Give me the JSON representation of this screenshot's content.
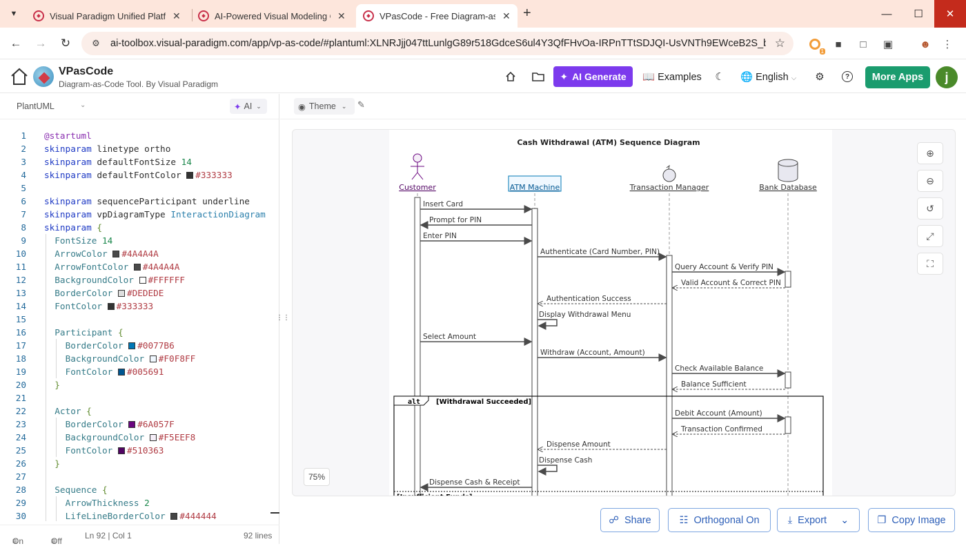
{
  "browser": {
    "tabs": [
      {
        "title": "Visual Paradigm Unified Platform"
      },
      {
        "title": "AI-Powered Visual Modeling Chatbot"
      },
      {
        "title": "VPasCode - Free Diagram-as-Code Tool"
      }
    ],
    "url": "ai-toolbox.visual-paradigm.com/app/vp-as-code/#plantuml:XLNRJjj047ttLunlgG89r518GdceS6ul4Y3QfFHvOa-IRPnTTtSDJQI-UsVNTh9EWceB2S_bd3ENt...",
    "ext_badge": "1"
  },
  "app": {
    "title": "VPasCode",
    "subtitle": "Diagram-as-Code Tool. By Visual Paradigm",
    "ai_generate": "AI Generate",
    "examples": "Examples",
    "language": "English",
    "more_apps": "More Apps",
    "avatar_initial": "j"
  },
  "editor": {
    "language": "PlantUML",
    "ai_label": "AI",
    "lines": [
      {
        "n": "1",
        "parts": [
          [
            "dir",
            "@startuml"
          ]
        ]
      },
      {
        "n": "2",
        "parts": [
          [
            "kw",
            "skinparam"
          ],
          [
            "pl",
            " linetype ortho"
          ]
        ]
      },
      {
        "n": "3",
        "parts": [
          [
            "kw",
            "skinparam"
          ],
          [
            "pl",
            " defaultFontSize "
          ],
          [
            "num",
            "14"
          ]
        ]
      },
      {
        "n": "4",
        "parts": [
          [
            "kw",
            "skinparam"
          ],
          [
            "pl",
            " defaultFontColor "
          ],
          [
            "sw",
            "#333333"
          ],
          [
            "hex",
            "#333333"
          ]
        ]
      },
      {
        "n": "5",
        "parts": []
      },
      {
        "n": "6",
        "parts": [
          [
            "kw",
            "skinparam"
          ],
          [
            "pl",
            " sequenceParticipant underline"
          ]
        ]
      },
      {
        "n": "7",
        "parts": [
          [
            "kw",
            "skinparam"
          ],
          [
            "pl",
            " vpDiagramType "
          ],
          [
            "val",
            "InteractionDiagram"
          ]
        ]
      },
      {
        "n": "8",
        "parts": [
          [
            "kw",
            "skinparam"
          ],
          [
            "pl",
            " "
          ],
          [
            "br",
            "{"
          ]
        ]
      },
      {
        "n": "9",
        "indent": 1,
        "parts": [
          [
            "prop",
            "FontSize "
          ],
          [
            "num",
            "14"
          ]
        ]
      },
      {
        "n": "10",
        "indent": 1,
        "parts": [
          [
            "prop",
            "ArrowColor "
          ],
          [
            "sw",
            "#4A4A4A"
          ],
          [
            "hex",
            "#4A4A4A"
          ]
        ]
      },
      {
        "n": "11",
        "indent": 1,
        "parts": [
          [
            "prop",
            "ArrowFontColor "
          ],
          [
            "sw",
            "#4A4A4A"
          ],
          [
            "hex",
            "#4A4A4A"
          ]
        ]
      },
      {
        "n": "12",
        "indent": 1,
        "parts": [
          [
            "prop",
            "BackgroundColor "
          ],
          [
            "sw",
            "#FFFFFF"
          ],
          [
            "hex",
            "#FFFFFF"
          ]
        ]
      },
      {
        "n": "13",
        "indent": 1,
        "parts": [
          [
            "prop",
            "BorderColor "
          ],
          [
            "sw",
            "#DEDEDE"
          ],
          [
            "hex",
            "#DEDEDE"
          ]
        ]
      },
      {
        "n": "14",
        "indent": 1,
        "parts": [
          [
            "prop",
            "FontColor "
          ],
          [
            "sw",
            "#333333"
          ],
          [
            "hex",
            "#333333"
          ]
        ]
      },
      {
        "n": "15",
        "indent": 1,
        "parts": []
      },
      {
        "n": "16",
        "indent": 1,
        "parts": [
          [
            "prop",
            "Participant "
          ],
          [
            "br",
            "{"
          ]
        ]
      },
      {
        "n": "17",
        "indent": 2,
        "parts": [
          [
            "prop",
            "BorderColor "
          ],
          [
            "sw",
            "#0077B6"
          ],
          [
            "hex",
            "#0077B6"
          ]
        ]
      },
      {
        "n": "18",
        "indent": 2,
        "parts": [
          [
            "prop",
            "BackgroundColor "
          ],
          [
            "sw",
            "#F0F8FF"
          ],
          [
            "hex",
            "#F0F8FF"
          ]
        ]
      },
      {
        "n": "19",
        "indent": 2,
        "parts": [
          [
            "prop",
            "FontColor "
          ],
          [
            "sw",
            "#005691"
          ],
          [
            "hex",
            "#005691"
          ]
        ]
      },
      {
        "n": "20",
        "indent": 1,
        "parts": [
          [
            "br",
            "}"
          ]
        ]
      },
      {
        "n": "21",
        "indent": 1,
        "parts": []
      },
      {
        "n": "22",
        "indent": 1,
        "parts": [
          [
            "prop",
            "Actor "
          ],
          [
            "br",
            "{"
          ]
        ]
      },
      {
        "n": "23",
        "indent": 2,
        "parts": [
          [
            "prop",
            "BorderColor "
          ],
          [
            "sw",
            "#6A057F"
          ],
          [
            "hex",
            "#6A057F"
          ]
        ]
      },
      {
        "n": "24",
        "indent": 2,
        "parts": [
          [
            "prop",
            "BackgroundColor "
          ],
          [
            "sw",
            "#F5EEF8"
          ],
          [
            "hex",
            "#F5EEF8"
          ]
        ]
      },
      {
        "n": "25",
        "indent": 2,
        "parts": [
          [
            "prop",
            "FontColor "
          ],
          [
            "sw",
            "#510363"
          ],
          [
            "hex",
            "#510363"
          ]
        ]
      },
      {
        "n": "26",
        "indent": 1,
        "parts": [
          [
            "br",
            "}"
          ]
        ]
      },
      {
        "n": "27",
        "indent": 1,
        "parts": []
      },
      {
        "n": "28",
        "indent": 1,
        "parts": [
          [
            "prop",
            "Sequence "
          ],
          [
            "br",
            "{"
          ]
        ]
      },
      {
        "n": "29",
        "indent": 2,
        "parts": [
          [
            "prop",
            "ArrowThickness "
          ],
          [
            "num",
            "2"
          ]
        ]
      },
      {
        "n": "30",
        "indent": 2,
        "parts": [
          [
            "prop",
            "LifeLineBorderColor "
          ],
          [
            "sw",
            "#444444"
          ],
          [
            "hex",
            "#444444"
          ]
        ]
      }
    ],
    "footer": {
      "wrap": "On",
      "format": "Off",
      "position": "Ln 92 | Col 1",
      "count": "92 lines"
    }
  },
  "preview": {
    "theme_label": "Theme",
    "zoom": "75%",
    "buttons": {
      "share": "Share",
      "orthogonal": "Orthogonal On",
      "export": "Export",
      "copy": "Copy Image"
    }
  },
  "diagram": {
    "title": "Cash Withdrawal (ATM) Sequence Diagram",
    "participants": [
      {
        "id": "customer",
        "label": "Customer",
        "kind": "actor"
      },
      {
        "id": "atm",
        "label": "ATM Machine",
        "kind": "participant"
      },
      {
        "id": "tm",
        "label": "Transaction Manager",
        "kind": "control"
      },
      {
        "id": "db",
        "label": "Bank Database",
        "kind": "database"
      }
    ],
    "messages": [
      {
        "from": "customer",
        "to": "atm",
        "label": "Insert Card",
        "type": "sync"
      },
      {
        "from": "atm",
        "to": "customer",
        "label": "Prompt for PIN",
        "type": "sync"
      },
      {
        "from": "customer",
        "to": "atm",
        "label": "Enter PIN",
        "type": "sync"
      },
      {
        "from": "atm",
        "to": "tm",
        "label": "Authenticate (Card Number, PIN)",
        "type": "sync"
      },
      {
        "from": "tm",
        "to": "db",
        "label": "Query Account & Verify PIN",
        "type": "sync"
      },
      {
        "from": "db",
        "to": "tm",
        "label": "Valid Account & Correct PIN",
        "type": "return"
      },
      {
        "from": "tm",
        "to": "atm",
        "label": "Authentication Success",
        "type": "return"
      },
      {
        "from": "atm",
        "to": "atm",
        "label": "Display Withdrawal Menu",
        "type": "self"
      },
      {
        "from": "customer",
        "to": "atm",
        "label": "Select Amount",
        "type": "sync"
      },
      {
        "from": "atm",
        "to": "tm",
        "label": "Withdraw (Account, Amount)",
        "type": "sync"
      },
      {
        "from": "tm",
        "to": "db",
        "label": "Check Available Balance",
        "type": "sync"
      },
      {
        "from": "db",
        "to": "tm",
        "label": "Balance Sufficient",
        "type": "return"
      },
      {
        "from": "tm",
        "to": "db",
        "label": "Debit Account (Amount)",
        "type": "sync"
      },
      {
        "from": "db",
        "to": "tm",
        "label": "Transaction Confirmed",
        "type": "return"
      },
      {
        "from": "tm",
        "to": "atm",
        "label": "Dispense Amount",
        "type": "return"
      },
      {
        "from": "atm",
        "to": "atm",
        "label": "Dispense Cash",
        "type": "self"
      },
      {
        "from": "atm",
        "to": "customer",
        "label": "Dispense Cash & Receipt",
        "type": "sync"
      }
    ],
    "fragment": {
      "keyword": "alt",
      "guard1": "[Withdrawal Succeeded]",
      "guard2": "[Insufficient Funds]"
    }
  }
}
